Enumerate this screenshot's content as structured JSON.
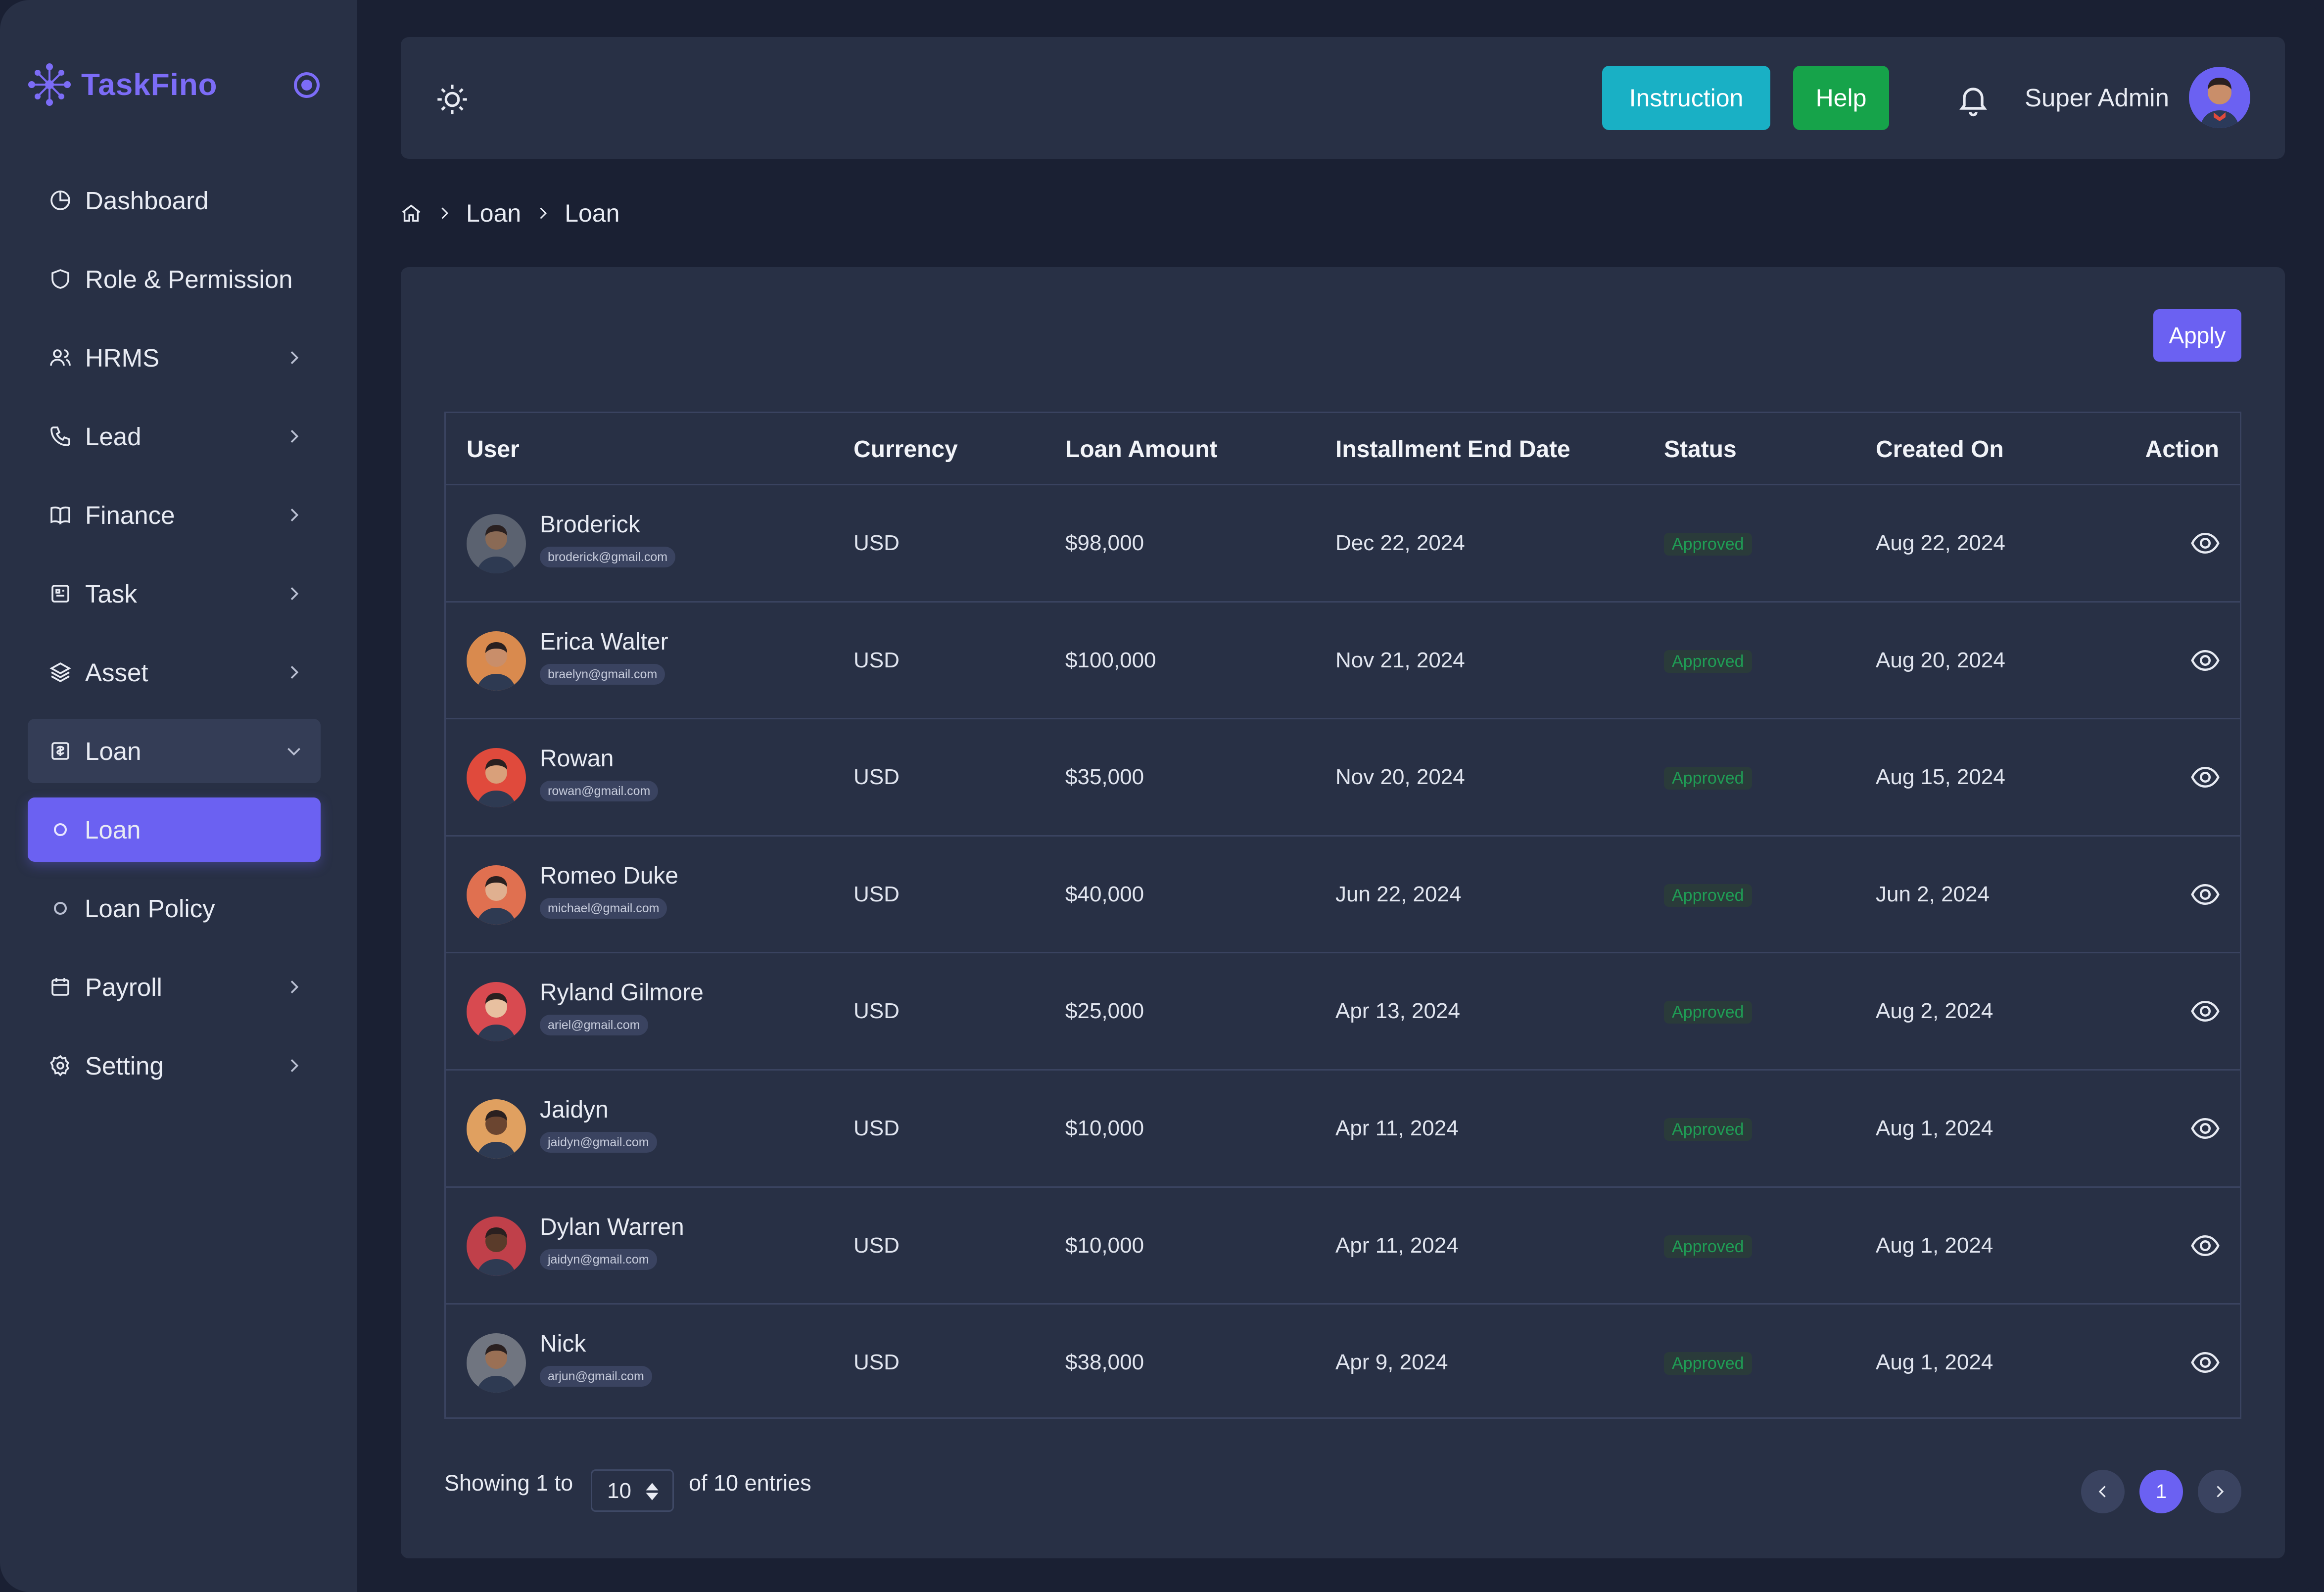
{
  "brand": {
    "name": "TaskFino",
    "accent": "#7c6cf7"
  },
  "sidebar": {
    "items": [
      {
        "label": "Dashboard",
        "icon": "dashboard-icon",
        "chevron": false
      },
      {
        "label": "Role & Permission",
        "icon": "shield-icon",
        "chevron": false
      },
      {
        "label": "HRMS",
        "icon": "users-icon",
        "chevron": true
      },
      {
        "label": "Lead",
        "icon": "phone-icon",
        "chevron": true
      },
      {
        "label": "Finance",
        "icon": "book-icon",
        "chevron": true
      },
      {
        "label": "Task",
        "icon": "task-icon",
        "chevron": true
      },
      {
        "label": "Asset",
        "icon": "layers-icon",
        "chevron": true
      },
      {
        "label": "Loan",
        "icon": "loan-icon",
        "chevron": true,
        "open": true
      },
      {
        "label": "Loan",
        "sub": true,
        "active": true
      },
      {
        "label": "Loan Policy",
        "sub": true
      },
      {
        "label": "Payroll",
        "icon": "calendar-icon",
        "chevron": true
      },
      {
        "label": "Setting",
        "icon": "gear-icon",
        "chevron": true
      }
    ]
  },
  "topbar": {
    "instruction_label": "Instruction",
    "help_label": "Help",
    "user_name": "Super Admin"
  },
  "breadcrumb": [
    "Loan",
    "Loan"
  ],
  "apply_label": "Apply",
  "table": {
    "headers": [
      "User",
      "Currency",
      "Loan Amount",
      "Installment End Date",
      "Status",
      "Created On",
      "Action"
    ],
    "rows": [
      {
        "name": "Broderick",
        "email": "broderick@gmail.com",
        "currency": "USD",
        "amount": "$98,000",
        "end": "Dec 22, 2024",
        "status": "Approved",
        "created": "Aug 22, 2024",
        "skin": "#8a6a55",
        "bg": "#5b6270"
      },
      {
        "name": "Erica Walter",
        "email": "braelyn@gmail.com",
        "currency": "USD",
        "amount": "$100,000",
        "end": "Nov 21, 2024",
        "status": "Approved",
        "created": "Aug 20, 2024",
        "skin": "#c98e6a",
        "bg": "#d98a4e"
      },
      {
        "name": "Rowan",
        "email": "rowan@gmail.com",
        "currency": "USD",
        "amount": "$35,000",
        "end": "Nov 20, 2024",
        "status": "Approved",
        "created": "Aug 15, 2024",
        "skin": "#d9a07a",
        "bg": "#e04a3c"
      },
      {
        "name": "Romeo Duke",
        "email": "michael@gmail.com",
        "currency": "USD",
        "amount": "$40,000",
        "end": "Jun 22, 2024",
        "status": "Approved",
        "created": "Jun 2, 2024",
        "skin": "#e0b090",
        "bg": "#e07050"
      },
      {
        "name": "Ryland Gilmore",
        "email": "ariel@gmail.com",
        "currency": "USD",
        "amount": "$25,000",
        "end": "Apr 13, 2024",
        "status": "Approved",
        "created": "Aug 2, 2024",
        "skin": "#e8c0a0",
        "bg": "#d84a50"
      },
      {
        "name": "Jaidyn",
        "email": "jaidyn@gmail.com",
        "currency": "USD",
        "amount": "$10,000",
        "end": "Apr 11, 2024",
        "status": "Approved",
        "created": "Aug 1, 2024",
        "skin": "#6b4530",
        "bg": "#e0a060"
      },
      {
        "name": "Dylan Warren",
        "email": "jaidyn@gmail.com",
        "currency": "USD",
        "amount": "$10,000",
        "end": "Apr 11, 2024",
        "status": "Approved",
        "created": "Aug 1, 2024",
        "skin": "#5a3b2a",
        "bg": "#c0404a"
      },
      {
        "name": "Nick",
        "email": "arjun@gmail.com",
        "currency": "USD",
        "amount": "$38,000",
        "end": "Apr 9, 2024",
        "status": "Approved",
        "created": "Aug 1, 2024",
        "skin": "#9a7055",
        "bg": "#707580"
      }
    ]
  },
  "footer": {
    "showing_prefix": "Showing 1 to",
    "per_page": "10",
    "showing_suffix": "of 10 entries",
    "current_page": "1"
  },
  "colors": {
    "background": "#1a2033",
    "panel": "#283045",
    "accent": "#6b61f2",
    "instruction": "#19b0c5",
    "help": "#16a34a",
    "approved": "#1f9d55"
  }
}
